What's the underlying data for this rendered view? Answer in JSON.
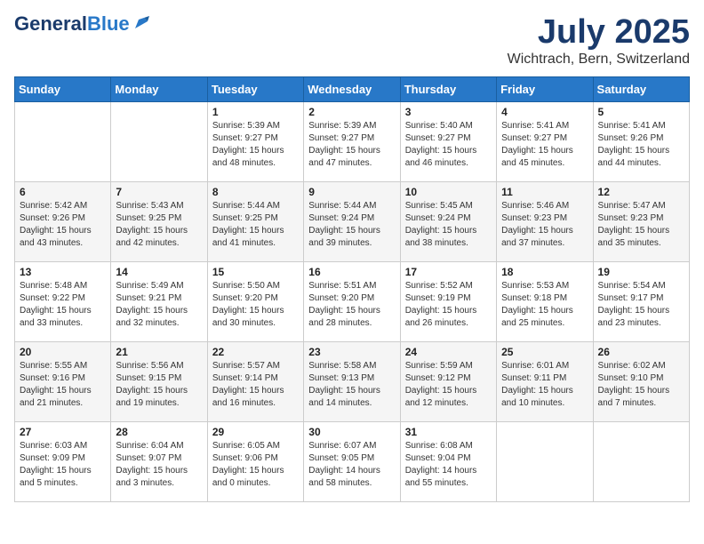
{
  "logo": {
    "text_general": "General",
    "text_blue": "Blue"
  },
  "header": {
    "month_title": "July 2025",
    "location": "Wichtrach, Bern, Switzerland"
  },
  "weekdays": [
    "Sunday",
    "Monday",
    "Tuesday",
    "Wednesday",
    "Thursday",
    "Friday",
    "Saturday"
  ],
  "weeks": [
    [
      {
        "day": "",
        "sunrise": "",
        "sunset": "",
        "daylight": ""
      },
      {
        "day": "",
        "sunrise": "",
        "sunset": "",
        "daylight": ""
      },
      {
        "day": "1",
        "sunrise": "Sunrise: 5:39 AM",
        "sunset": "Sunset: 9:27 PM",
        "daylight": "Daylight: 15 hours and 48 minutes."
      },
      {
        "day": "2",
        "sunrise": "Sunrise: 5:39 AM",
        "sunset": "Sunset: 9:27 PM",
        "daylight": "Daylight: 15 hours and 47 minutes."
      },
      {
        "day": "3",
        "sunrise": "Sunrise: 5:40 AM",
        "sunset": "Sunset: 9:27 PM",
        "daylight": "Daylight: 15 hours and 46 minutes."
      },
      {
        "day": "4",
        "sunrise": "Sunrise: 5:41 AM",
        "sunset": "Sunset: 9:27 PM",
        "daylight": "Daylight: 15 hours and 45 minutes."
      },
      {
        "day": "5",
        "sunrise": "Sunrise: 5:41 AM",
        "sunset": "Sunset: 9:26 PM",
        "daylight": "Daylight: 15 hours and 44 minutes."
      }
    ],
    [
      {
        "day": "6",
        "sunrise": "Sunrise: 5:42 AM",
        "sunset": "Sunset: 9:26 PM",
        "daylight": "Daylight: 15 hours and 43 minutes."
      },
      {
        "day": "7",
        "sunrise": "Sunrise: 5:43 AM",
        "sunset": "Sunset: 9:25 PM",
        "daylight": "Daylight: 15 hours and 42 minutes."
      },
      {
        "day": "8",
        "sunrise": "Sunrise: 5:44 AM",
        "sunset": "Sunset: 9:25 PM",
        "daylight": "Daylight: 15 hours and 41 minutes."
      },
      {
        "day": "9",
        "sunrise": "Sunrise: 5:44 AM",
        "sunset": "Sunset: 9:24 PM",
        "daylight": "Daylight: 15 hours and 39 minutes."
      },
      {
        "day": "10",
        "sunrise": "Sunrise: 5:45 AM",
        "sunset": "Sunset: 9:24 PM",
        "daylight": "Daylight: 15 hours and 38 minutes."
      },
      {
        "day": "11",
        "sunrise": "Sunrise: 5:46 AM",
        "sunset": "Sunset: 9:23 PM",
        "daylight": "Daylight: 15 hours and 37 minutes."
      },
      {
        "day": "12",
        "sunrise": "Sunrise: 5:47 AM",
        "sunset": "Sunset: 9:23 PM",
        "daylight": "Daylight: 15 hours and 35 minutes."
      }
    ],
    [
      {
        "day": "13",
        "sunrise": "Sunrise: 5:48 AM",
        "sunset": "Sunset: 9:22 PM",
        "daylight": "Daylight: 15 hours and 33 minutes."
      },
      {
        "day": "14",
        "sunrise": "Sunrise: 5:49 AM",
        "sunset": "Sunset: 9:21 PM",
        "daylight": "Daylight: 15 hours and 32 minutes."
      },
      {
        "day": "15",
        "sunrise": "Sunrise: 5:50 AM",
        "sunset": "Sunset: 9:20 PM",
        "daylight": "Daylight: 15 hours and 30 minutes."
      },
      {
        "day": "16",
        "sunrise": "Sunrise: 5:51 AM",
        "sunset": "Sunset: 9:20 PM",
        "daylight": "Daylight: 15 hours and 28 minutes."
      },
      {
        "day": "17",
        "sunrise": "Sunrise: 5:52 AM",
        "sunset": "Sunset: 9:19 PM",
        "daylight": "Daylight: 15 hours and 26 minutes."
      },
      {
        "day": "18",
        "sunrise": "Sunrise: 5:53 AM",
        "sunset": "Sunset: 9:18 PM",
        "daylight": "Daylight: 15 hours and 25 minutes."
      },
      {
        "day": "19",
        "sunrise": "Sunrise: 5:54 AM",
        "sunset": "Sunset: 9:17 PM",
        "daylight": "Daylight: 15 hours and 23 minutes."
      }
    ],
    [
      {
        "day": "20",
        "sunrise": "Sunrise: 5:55 AM",
        "sunset": "Sunset: 9:16 PM",
        "daylight": "Daylight: 15 hours and 21 minutes."
      },
      {
        "day": "21",
        "sunrise": "Sunrise: 5:56 AM",
        "sunset": "Sunset: 9:15 PM",
        "daylight": "Daylight: 15 hours and 19 minutes."
      },
      {
        "day": "22",
        "sunrise": "Sunrise: 5:57 AM",
        "sunset": "Sunset: 9:14 PM",
        "daylight": "Daylight: 15 hours and 16 minutes."
      },
      {
        "day": "23",
        "sunrise": "Sunrise: 5:58 AM",
        "sunset": "Sunset: 9:13 PM",
        "daylight": "Daylight: 15 hours and 14 minutes."
      },
      {
        "day": "24",
        "sunrise": "Sunrise: 5:59 AM",
        "sunset": "Sunset: 9:12 PM",
        "daylight": "Daylight: 15 hours and 12 minutes."
      },
      {
        "day": "25",
        "sunrise": "Sunrise: 6:01 AM",
        "sunset": "Sunset: 9:11 PM",
        "daylight": "Daylight: 15 hours and 10 minutes."
      },
      {
        "day": "26",
        "sunrise": "Sunrise: 6:02 AM",
        "sunset": "Sunset: 9:10 PM",
        "daylight": "Daylight: 15 hours and 7 minutes."
      }
    ],
    [
      {
        "day": "27",
        "sunrise": "Sunrise: 6:03 AM",
        "sunset": "Sunset: 9:09 PM",
        "daylight": "Daylight: 15 hours and 5 minutes."
      },
      {
        "day": "28",
        "sunrise": "Sunrise: 6:04 AM",
        "sunset": "Sunset: 9:07 PM",
        "daylight": "Daylight: 15 hours and 3 minutes."
      },
      {
        "day": "29",
        "sunrise": "Sunrise: 6:05 AM",
        "sunset": "Sunset: 9:06 PM",
        "daylight": "Daylight: 15 hours and 0 minutes."
      },
      {
        "day": "30",
        "sunrise": "Sunrise: 6:07 AM",
        "sunset": "Sunset: 9:05 PM",
        "daylight": "Daylight: 14 hours and 58 minutes."
      },
      {
        "day": "31",
        "sunrise": "Sunrise: 6:08 AM",
        "sunset": "Sunset: 9:04 PM",
        "daylight": "Daylight: 14 hours and 55 minutes."
      },
      {
        "day": "",
        "sunrise": "",
        "sunset": "",
        "daylight": ""
      },
      {
        "day": "",
        "sunrise": "",
        "sunset": "",
        "daylight": ""
      }
    ]
  ]
}
